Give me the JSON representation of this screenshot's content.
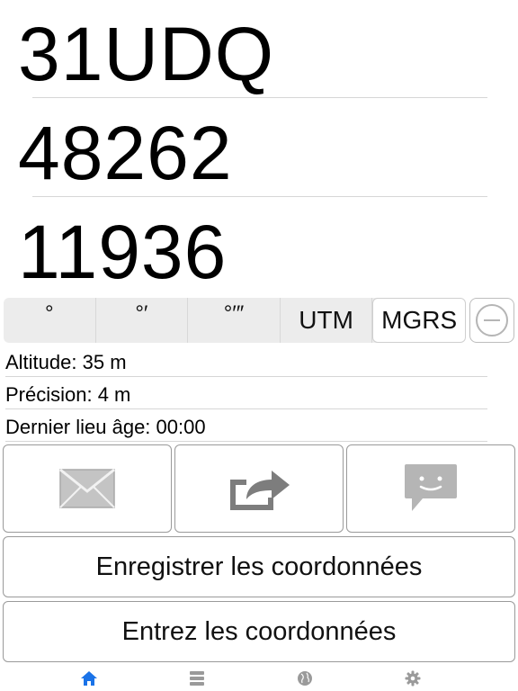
{
  "coordinates": {
    "zone": "31UDQ",
    "easting": "48262",
    "northing": "11936"
  },
  "format_selector": {
    "options": [
      "°",
      "°′",
      "°′″",
      "UTM",
      "MGRS"
    ],
    "selected": "MGRS"
  },
  "info": {
    "altitude": "Altitude: 35 m",
    "precision": "Précision: 4 m",
    "last_location_age": "Dernier lieu âge: 00:00"
  },
  "actions": {
    "save_label": "Enregistrer les coordonnées",
    "enter_label": "Entrez les coordonnées"
  },
  "icons": {
    "mail": "mail-icon",
    "share": "share-icon",
    "message": "message-icon",
    "remove": "minus-circle-icon"
  },
  "tabbar": {
    "items": [
      "home-icon",
      "list-icon",
      "globe-icon",
      "settings-icon"
    ],
    "active": "home-icon",
    "active_color": "#1a73e8",
    "inactive_color": "#9a9a9a"
  }
}
